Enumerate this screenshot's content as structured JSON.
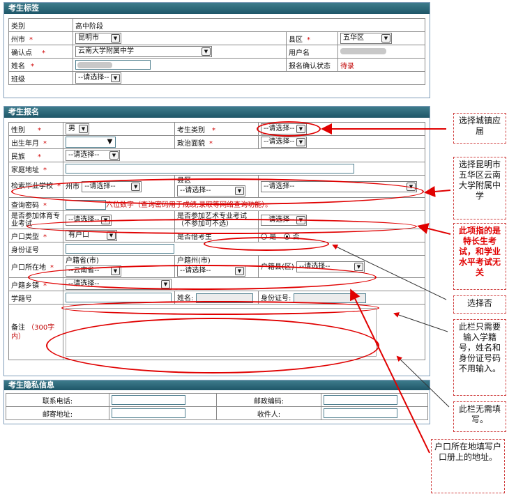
{
  "tag_panel": {
    "title": "考生标签",
    "category_label": "类别",
    "category_value": "高中阶段",
    "city_label": "州市",
    "city_value": "昆明市",
    "county_label": "县区",
    "county_value": "五华区",
    "confirm_label": "确认点",
    "confirm_value": "云南大学附属中学",
    "username_label": "用户名",
    "name_label": "姓名",
    "status_label": "报名确认状态",
    "status_value": "待录",
    "class_label": "班级",
    "class_value": "--请选择--",
    "req": "*"
  },
  "reg_panel": {
    "title": "考生报名",
    "gender_label": "性别",
    "gender_value": "男",
    "stu_type_label": "考生类别",
    "stu_type_value": "--请选择--",
    "birth_label": "出生年月",
    "political_label": "政治面貌",
    "political_value": "--请选择--",
    "ethnic_label": "民族",
    "ethnic_value": "--请选择--",
    "address_label": "家庭地址",
    "school_label": "检索毕业学校",
    "school_city_label": "州市",
    "school_city_value": "--请选择--",
    "school_county_label": "县区",
    "school_county_value": "--请选择--",
    "school_value": "--请选择--",
    "pwd_label": "查询密码",
    "pwd_hint": "六位数字（查询密码用于成绩,录取等网络查询功能）。",
    "pe_label": "是否参加体育专业考试",
    "pe_value": "--请选择--",
    "art_label": "是否参加艺术专业考试",
    "art_sub": "（不参加可不选）",
    "art_value": "--请选择--",
    "hukou_type_label": "户口类型",
    "hukou_type_value": "有户口",
    "borrow_label": "是否借考生",
    "radio_yes": "是",
    "radio_no": "否",
    "id_label": "身份证号",
    "hukou_loc_label": "户口所在地",
    "prov_label": "户籍省(市)",
    "prov_value": "--云南省--",
    "pref_label": "户籍州(市)",
    "pref_value": "--请选择--",
    "cnty_label": "户籍县(区)",
    "cnty_value": "--请选择--",
    "town_label": "户籍乡镇",
    "town_value": "--请选择--",
    "stuno_label": "学籍号",
    "sname_label": "姓名:",
    "sid_label": "身份证号:",
    "remark_label": "备注",
    "remark_hint": "（300字内）",
    "req": "*"
  },
  "priv_panel": {
    "title": "考生隐私信息",
    "phone_label": "联系电话:",
    "zip_label": "邮政编码:",
    "mail_label": "邮寄地址:",
    "recv_label": "收件人:"
  },
  "notes": {
    "n1": "选择城镇应届",
    "n2": "选择昆明市五华区云南大学附属中学",
    "n3": "此项指的是特长生考试，和学业水平考试无关",
    "n4": "选择否",
    "n5": "此栏只需要输入学籍号，姓名和身份证号码不用输入。",
    "n6": "此栏无需填写。",
    "n7": "户口所在地填写户口册上的地址。"
  }
}
